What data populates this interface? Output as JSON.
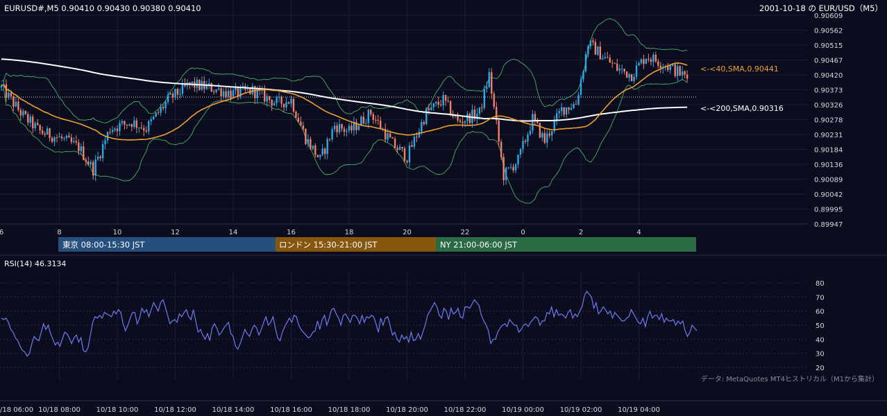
{
  "header": {
    "symbol_info": "EURUSD#,M5 0.90410 0.90430 0.90380 0.90410",
    "right_title": "2001-10-18 の EUR/USD（M5）"
  },
  "colors": {
    "background": "#0b0c1e",
    "bull": "#2fa9e6",
    "bear": "#f0826a",
    "sma40": "#f0a030",
    "sma200": "#ffffff",
    "bollinger": "#4caf6a",
    "rsi": "#6e7cf2"
  },
  "chart_data": [
    {
      "type": "candlestick",
      "price_axis": {
        "ticks": [
          "0.90609",
          "0.90562",
          "0.90515",
          "0.90467",
          "0.90420",
          "0.90373",
          "0.90326",
          "0.90278",
          "0.90231",
          "0.90184",
          "0.90136",
          "0.90089",
          "0.90042",
          "0.89995",
          "0.89947"
        ],
        "range": [
          0.89947,
          0.90609
        ]
      },
      "time_axis_labels": [
        "6",
        "8",
        "10",
        "12",
        "14",
        "16",
        "18",
        "20",
        "22",
        "0",
        "2",
        "4"
      ],
      "reference_line": 0.90348,
      "indicators": [
        {
          "name": "SMA40",
          "label": "<-<40,SMA,0.90441",
          "last": 0.90441
        },
        {
          "name": "SMA200",
          "label": "<-<200,SMA,0.90316",
          "last": 0.90316
        }
      ],
      "price_path_keypoints": [
        {
          "t": "06:00",
          "p": 0.9038
        },
        {
          "t": "06:45",
          "p": 0.9029
        },
        {
          "t": "07:20",
          "p": 0.9024
        },
        {
          "t": "08:00",
          "p": 0.9022
        },
        {
          "t": "08:40",
          "p": 0.9019
        },
        {
          "t": "09:10",
          "p": 0.9012
        },
        {
          "t": "09:45",
          "p": 0.9025
        },
        {
          "t": "10:30",
          "p": 0.9027
        },
        {
          "t": "11:00",
          "p": 0.9025
        },
        {
          "t": "11:45",
          "p": 0.9034
        },
        {
          "t": "12:30",
          "p": 0.9039
        },
        {
          "t": "13:10",
          "p": 0.9038
        },
        {
          "t": "14:00",
          "p": 0.9036
        },
        {
          "t": "14:40",
          "p": 0.9037
        },
        {
          "t": "15:30",
          "p": 0.9033
        },
        {
          "t": "16:00",
          "p": 0.9034
        },
        {
          "t": "16:30",
          "p": 0.9022
        },
        {
          "t": "17:00",
          "p": 0.9015
        },
        {
          "t": "17:30",
          "p": 0.9026
        },
        {
          "t": "18:00",
          "p": 0.9024
        },
        {
          "t": "18:45",
          "p": 0.903
        },
        {
          "t": "19:30",
          "p": 0.902
        },
        {
          "t": "20:00",
          "p": 0.9016
        },
        {
          "t": "20:40",
          "p": 0.903
        },
        {
          "t": "21:15",
          "p": 0.9034
        },
        {
          "t": "21:45",
          "p": 0.9027
        },
        {
          "t": "22:30",
          "p": 0.903
        },
        {
          "t": "22:50",
          "p": 0.9042
        },
        {
          "t": "23:20",
          "p": 0.901
        },
        {
          "t": "23:50",
          "p": 0.9015
        },
        {
          "t": "00:20",
          "p": 0.9028
        },
        {
          "t": "00:45",
          "p": 0.9021
        },
        {
          "t": "01:20",
          "p": 0.9031
        },
        {
          "t": "01:50",
          "p": 0.9033
        },
        {
          "t": "02:15",
          "p": 0.9052
        },
        {
          "t": "02:45",
          "p": 0.9048
        },
        {
          "t": "03:15",
          "p": 0.9044
        },
        {
          "t": "03:45",
          "p": 0.9042
        },
        {
          "t": "04:15",
          "p": 0.9048
        },
        {
          "t": "04:45",
          "p": 0.9046
        },
        {
          "t": "05:20",
          "p": 0.9043
        },
        {
          "t": "05:40",
          "p": 0.9041
        }
      ]
    },
    {
      "type": "line",
      "title": "RSI(14) 46.3134",
      "ylim": [
        20,
        80
      ],
      "y_ticks": [
        "80",
        "70",
        "60",
        "50",
        "40",
        "30",
        "20"
      ],
      "values": [
        55,
        54,
        55,
        52,
        47,
        45,
        41,
        39,
        35,
        32,
        31,
        28,
        30,
        37,
        42,
        40,
        39,
        45,
        51,
        47,
        50,
        44,
        40,
        36,
        38,
        35,
        40,
        45,
        44,
        41,
        37,
        41,
        43,
        38,
        41,
        32,
        31,
        34,
        43,
        52,
        56,
        55,
        57,
        55,
        59,
        58,
        57,
        56,
        60,
        58,
        61,
        59,
        51,
        46,
        50,
        55,
        59,
        59,
        51,
        55,
        62,
        59,
        61,
        56,
        61,
        66,
        63,
        60,
        66,
        68,
        63,
        57,
        51,
        53,
        54,
        52,
        58,
        56,
        59,
        61,
        56,
        54,
        61,
        53,
        45,
        47,
        43,
        40,
        44,
        39,
        48,
        51,
        48,
        43,
        45,
        48,
        50,
        52,
        44,
        42,
        35,
        33,
        37,
        42,
        47,
        44,
        42,
        47,
        50,
        48,
        43,
        47,
        52,
        56,
        50,
        52,
        56,
        48,
        41,
        39,
        45,
        49,
        52,
        55,
        52,
        57,
        56,
        50,
        47,
        45,
        43,
        41,
        42,
        45,
        46,
        53,
        47,
        54,
        57,
        50,
        55,
        61,
        62,
        58,
        55,
        50,
        57,
        58,
        55,
        52,
        57,
        57,
        55,
        51,
        57,
        52,
        56,
        55,
        57,
        56,
        51,
        45,
        55,
        50,
        55,
        56,
        50,
        43,
        45,
        40,
        38,
        43,
        40,
        42,
        38,
        45,
        39,
        40,
        44,
        40,
        45,
        50,
        57,
        60,
        63,
        66,
        63,
        57,
        55,
        62,
        60,
        54,
        62,
        58,
        59,
        62,
        56,
        55,
        63,
        63,
        62,
        65,
        68,
        66,
        64,
        57,
        53,
        50,
        46,
        37,
        40,
        40,
        45,
        48,
        50,
        51,
        49,
        54,
        52,
        50,
        50,
        45,
        47,
        50,
        51,
        49,
        52,
        54,
        56,
        55,
        50,
        53,
        53,
        59,
        58,
        63,
        56,
        61,
        57,
        58,
        57,
        55,
        59,
        61,
        55,
        58,
        56,
        60,
        63,
        71,
        74,
        72,
        70,
        62,
        66,
        58,
        60,
        63,
        61,
        58,
        60,
        55,
        59,
        57,
        55,
        53,
        53,
        55,
        56,
        61,
        58,
        55,
        52,
        51,
        55,
        49,
        56,
        60,
        55,
        57,
        57,
        54,
        58,
        52,
        55,
        53,
        53,
        54,
        50,
        53,
        51,
        53,
        46,
        42,
        45,
        50,
        48,
        46
      ]
    }
  ],
  "sessions": [
    {
      "label": "東京 08:00-15:30 JST",
      "color": "#264f7e"
    },
    {
      "label": "ロンドン 15:30-21:00 JST",
      "color": "#87570f"
    },
    {
      "label": "NY 21:00-06:00 JST",
      "color": "#2a6b44"
    }
  ],
  "bottom_axis_labels": [
    "/18 06:00",
    "10/18 08:00",
    "10/18 10:00",
    "10/18 12:00",
    "10/18 14:00",
    "10/18 16:00",
    "10/18 18:00",
    "10/18 20:00",
    "10/18 22:00",
    "10/19 00:00",
    "10/19 02:00",
    "10/19 04:00"
  ],
  "source_note": "データ: MetaQuotes MT4ヒストリカル（M1から集計）"
}
